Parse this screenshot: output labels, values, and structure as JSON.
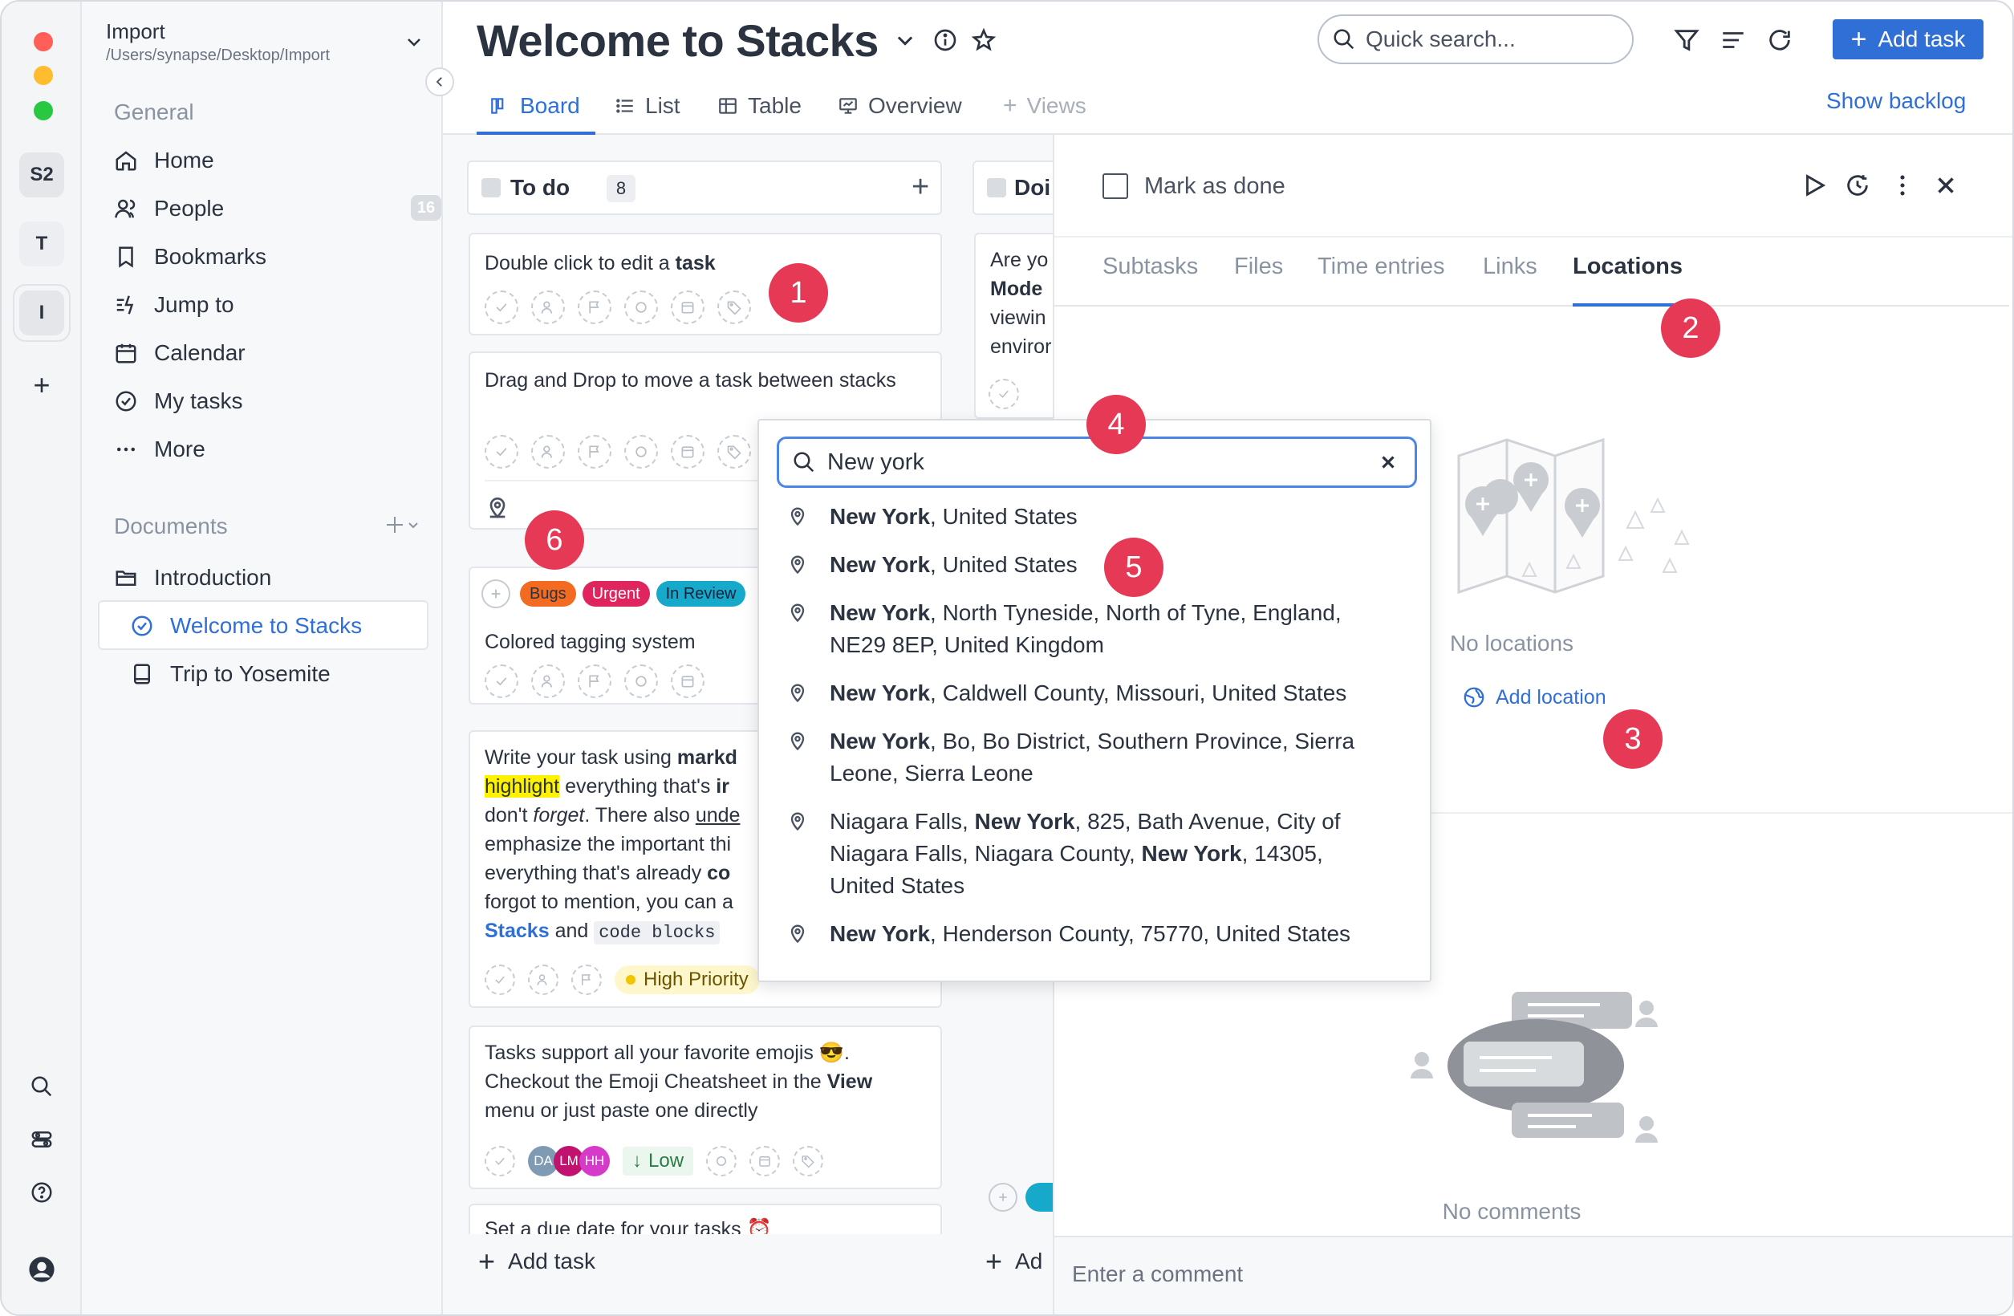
{
  "window": {
    "traffic_colors": [
      "#ff5f57",
      "#febc2e",
      "#28c840"
    ]
  },
  "rail": {
    "workspaces": [
      "S2",
      "T",
      "I"
    ],
    "add_label": "+"
  },
  "sidebar": {
    "project_name": "Import",
    "project_path": "/Users/synapse/Desktop/Import",
    "general_title": "General",
    "items": [
      {
        "label": "Home",
        "icon": "home-icon"
      },
      {
        "label": "People",
        "icon": "people-icon",
        "badge": "16"
      },
      {
        "label": "Bookmarks",
        "icon": "bookmark-icon"
      },
      {
        "label": "Jump to",
        "icon": "jump-icon"
      },
      {
        "label": "Calendar",
        "icon": "calendar-icon"
      },
      {
        "label": "My tasks",
        "icon": "check-circle-icon"
      },
      {
        "label": "More",
        "icon": "more-icon"
      }
    ],
    "documents_title": "Documents",
    "documents": [
      {
        "label": "Introduction",
        "icon": "folder-icon"
      },
      {
        "label": "Welcome to Stacks",
        "icon": "check-circle-icon",
        "active": true
      },
      {
        "label": "Trip to Yosemite",
        "icon": "book-icon"
      }
    ]
  },
  "header": {
    "title": "Welcome to Stacks",
    "search_placeholder": "Quick search...",
    "add_task_label": "Add task",
    "show_backlog": "Show backlog",
    "tabs": [
      {
        "label": "Board",
        "active": true
      },
      {
        "label": "List"
      },
      {
        "label": "Table"
      },
      {
        "label": "Overview"
      },
      {
        "label": "Views",
        "muted": true
      }
    ]
  },
  "board": {
    "column1": {
      "title": "To do",
      "count": "8",
      "add_task": "Add task"
    },
    "column2": {
      "title": "Doi",
      "add_task": "Ad",
      "card_text": [
        "Are yo",
        "Mode",
        "viewin",
        "enviror"
      ]
    },
    "cards": {
      "c1": {
        "text": "Double click to edit a ",
        "bold": "task"
      },
      "c2": {
        "text": "Drag and Drop to move a task between stacks"
      },
      "c3": {
        "tags": [
          "Bugs",
          "Urgent",
          "In Review"
        ],
        "text": "Colored tagging system"
      },
      "c4": {
        "lines": [
          {
            "a": "Write your task using ",
            "b": "markd"
          },
          {
            "hl": "highlight",
            "a": " everything that's ",
            "b": "ir"
          },
          {
            "a": "don't ",
            "i": "forget",
            "c": ". There also ",
            "u": "unde"
          },
          {
            "a": "emphasize the important thi"
          },
          {
            "a": "everything that's already ",
            "b": "co"
          },
          {
            "a": "forgot to mention, you can a"
          },
          {
            "link": "Stacks",
            "a": " and ",
            "code": "code blocks"
          }
        ],
        "priority": "High Priority"
      },
      "c5": {
        "line1": "Tasks support all your favorite emojis 😎.",
        "line2a": "Checkout the Emoji Cheatsheet in the ",
        "line2b": "View",
        "line3": "menu or just paste one directly",
        "avatars": [
          "DA",
          "LM",
          "HH"
        ],
        "priority": "Low"
      },
      "c6": {
        "text": "Set a due date for your tasks ⏰"
      }
    }
  },
  "detail": {
    "mark_done": "Mark as done",
    "tabs": [
      "Subtasks",
      "Files",
      "Time entries",
      "Links",
      "Locations"
    ],
    "active_tab": "Locations",
    "no_locations": "No locations",
    "add_location": "Add location",
    "no_comments": "No comments",
    "comment_placeholder": "Enter a comment"
  },
  "location_search": {
    "query": "New york",
    "results": [
      {
        "bold": "New York",
        "rest": ", United States"
      },
      {
        "bold": "New York",
        "rest": ", United States"
      },
      {
        "bold": "New York",
        "rest": ", North Tyneside, North of Tyne, England,",
        "line2": "NE29 8EP, United Kingdom"
      },
      {
        "bold": "New York",
        "rest": ", Caldwell County, Missouri, United States"
      },
      {
        "bold": "New York",
        "rest": ", Bo, Bo District, Southern Province, Sierra",
        "line2": "Leone, Sierra Leone"
      },
      {
        "pre": "Niagara Falls, ",
        "bold": "New York",
        "rest": ", 825, Bath Avenue, City of",
        "line2a": "Niagara Falls, Niagara County, ",
        "line2b": "New York",
        "line2c": ", 14305,",
        "line3": "United States"
      },
      {
        "bold": "New York",
        "rest": ", Henderson County, 75770, United States"
      }
    ]
  },
  "callouts": [
    "1",
    "2",
    "3",
    "4",
    "5",
    "6"
  ],
  "colors": {
    "accent": "#2f6fd6",
    "callout": "#e63955",
    "tag_bugs": "#f26b21",
    "tag_urgent": "#e0245e",
    "tag_review": "#16a9c9"
  }
}
